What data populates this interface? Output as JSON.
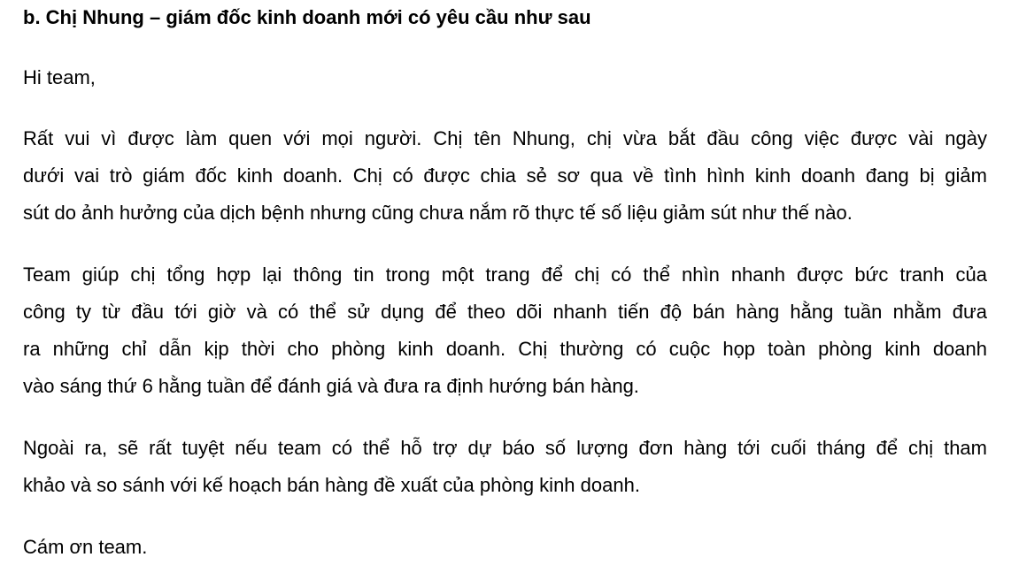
{
  "heading": "b. Chị Nhung – giám đốc kinh doanh mới có yêu cầu như sau",
  "greeting": "Hi team,",
  "paragraphs": [
    {
      "lines": [
        "Rất vui vì được làm quen với mọi người. Chị tên Nhung, chị vừa bắt đầu công việc được vài ngày",
        "dưới vai trò giám đốc kinh doanh. Chị có được chia sẻ sơ qua về tình hình kinh doanh đang bị giảm",
        "sút do ảnh hưởng của dịch bệnh nhưng cũng chưa nắm rõ thực tế số liệu giảm sút như thế nào."
      ]
    },
    {
      "lines": [
        "Team giúp chị tổng hợp lại thông tin trong một trang để chị có thể nhìn nhanh được bức tranh của",
        "công ty từ đầu tới giờ và có thể sử dụng để theo dõi nhanh tiến độ bán hàng hằng tuần nhằm đưa",
        "ra những chỉ dẫn kịp thời cho phòng kinh doanh. Chị thường có cuộc họp toàn phòng kinh doanh",
        "vào sáng thứ 6 hằng tuần để đánh giá và đưa ra định hướng bán hàng."
      ]
    },
    {
      "lines": [
        "Ngoài ra, sẽ rất tuyệt nếu team có thể hỗ trợ dự báo số lượng đơn hàng tới cuối tháng để chị tham",
        "khảo và so sánh với kế hoạch bán hàng đề xuất của phòng kinh doanh."
      ]
    }
  ],
  "closing": "Cám ơn team."
}
